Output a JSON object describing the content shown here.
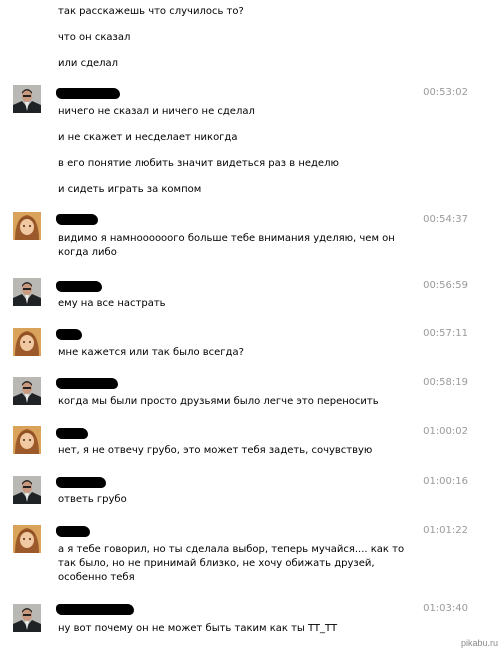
{
  "intro_lines": [
    "так расскажешь что случилось то?",
    "что он сказал",
    "или сделал"
  ],
  "messages": [
    {
      "sender": "man",
      "time": "00:53:02",
      "lines": [
        "ничего не сказал и ничего не сделал",
        "и не скажет и несделает никогда",
        "в его понятие любить значит видеться раз в неделю",
        "и сидеть играть за компом"
      ]
    },
    {
      "sender": "girl",
      "time": "00:54:37",
      "lines": [
        "видимо я намноооооого больше тебе внимания уделяю, чем он",
        "когда либо"
      ]
    },
    {
      "sender": "man",
      "time": "00:56:59",
      "lines": [
        "ему на все настрать"
      ]
    },
    {
      "sender": "girl",
      "time": "00:57:11",
      "lines": [
        "мне кажется или так было всегда?"
      ]
    },
    {
      "sender": "man",
      "time": "00:58:19",
      "lines": [
        "когда мы были просто друзьями было легче это переносить"
      ]
    },
    {
      "sender": "girl",
      "time": "01:00:02",
      "lines": [
        "нет, я не отвечу грубо, это может тебя задеть, сочувствую"
      ]
    },
    {
      "sender": "man",
      "time": "01:00:16",
      "lines": [
        "ответь грубо"
      ]
    },
    {
      "sender": "girl",
      "time": "01:01:22",
      "lines": [
        "а я тебе говорил, но ты сделала выбор, теперь мучайся.... как то",
        "так было, но не принимай близко, не хочу обижать друзей,",
        "особенно тебя"
      ]
    },
    {
      "sender": "man",
      "time": "01:03:40",
      "lines": [
        "ну вот почему он не может быть таким как ты TT_TT"
      ]
    }
  ],
  "watermark": "pikabu.ru",
  "colors": {
    "time": "#9a9a9a",
    "text": "#000000",
    "background": "#ffffff"
  }
}
